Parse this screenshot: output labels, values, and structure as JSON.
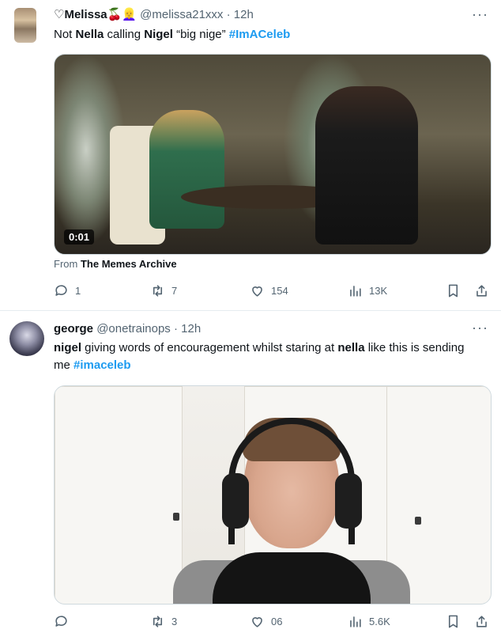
{
  "tweets": [
    {
      "display_name": "♡Melissa🍒👱‍♀️",
      "handle_time": "@melissa21xxx · 12h",
      "text_parts": [
        "Not ",
        "Nella",
        " calling ",
        "Nigel",
        " “big nige” ",
        "#ImACeleb"
      ],
      "media": {
        "duration": "0:01"
      },
      "source": {
        "prefix": "From",
        "name": "The Memes Archive"
      },
      "actions": {
        "reply_count": "1",
        "retweet_count": "7",
        "like_count": "154",
        "view_count": "13K"
      },
      "more_label": "···"
    },
    {
      "display_name": "george",
      "handle_time": "@onetrainops · 12h",
      "text_parts": [
        "nigel",
        " giving words of encouragement whilst staring at ",
        "nella",
        " like this is sending me ",
        "#imaceleb"
      ],
      "actions": {
        "reply_count": "",
        "retweet_count": "3",
        "like_count": "06",
        "view_count": "5.6K"
      },
      "more_label": "···"
    }
  ],
  "icons": {
    "reply": "reply-icon",
    "retweet": "retweet-icon",
    "like": "heart-icon",
    "views": "views-icon",
    "bookmark": "bookmark-icon",
    "share": "share-icon"
  },
  "colors": {
    "text": "#0f1419",
    "secondary": "#536471",
    "hashtag": "#1d9bf0",
    "divider": "#e6ecf0"
  }
}
